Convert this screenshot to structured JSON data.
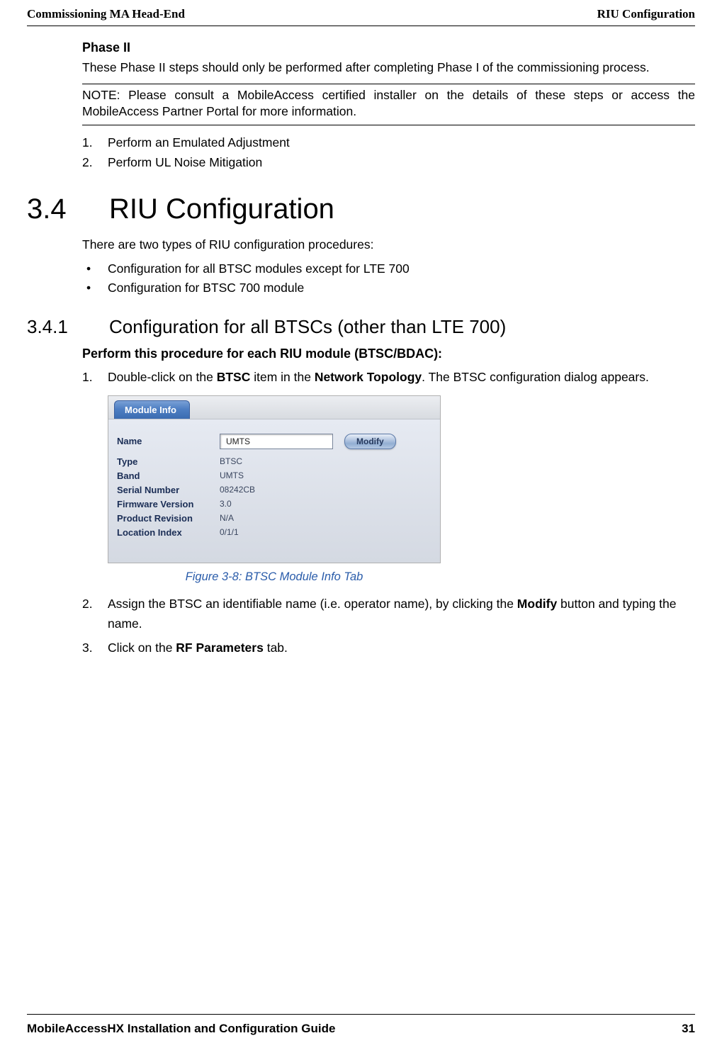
{
  "header": {
    "left": "Commissioning MA Head-End",
    "right": "RIU Configuration"
  },
  "phase2": {
    "title": "Phase II",
    "para": "These Phase II steps should only be performed after completing Phase I of the commissioning process.",
    "note": "NOTE: Please consult a MobileAccess certified installer on the details of these steps or access the MobileAccess Partner Portal for more information.",
    "items": [
      {
        "num": "1.",
        "text": "  Perform an Emulated Adjustment"
      },
      {
        "num": "2.",
        "text": "Perform UL Noise Mitigation"
      }
    ]
  },
  "s34": {
    "num": "3.4",
    "title": "RIU Configuration",
    "intro": "There are two types of RIU configuration procedures:",
    "bullets": [
      "Configuration for all  BTSC modules except for LTE 700",
      "Configuration for BTSC 700 module"
    ]
  },
  "s341": {
    "num": "3.4.1",
    "title": "Configuration for all BTSCs (other than LTE 700)",
    "subheading": "Perform this procedure for each RIU module (BTSC/BDAC):",
    "step1": {
      "num": "1.",
      "pre": "Double-click on the ",
      "b1": "BTSC",
      "mid": " item in the ",
      "b2": "Network Topology",
      "post": ". The BTSC configuration dialog appears."
    },
    "step2": {
      "num": "2.",
      "pre": "Assign the BTSC an identifiable name (i.e. operator name), by clicking the ",
      "b1": "Modify",
      "post": " button and typing the name."
    },
    "step3": {
      "num": "3.",
      "pre": "Click on the ",
      "b1": "RF Parameters",
      "post": " tab."
    }
  },
  "moduleInfo": {
    "tabLabel": "Module Info",
    "nameLabel": "Name",
    "nameValue": "UMTS",
    "modifyLabel": "Modify",
    "rows": [
      {
        "label": "Type",
        "value": "BTSC"
      },
      {
        "label": "Band",
        "value": "UMTS"
      },
      {
        "label": "Serial Number",
        "value": "08242CB"
      },
      {
        "label": "Firmware Version",
        "value": "3.0"
      },
      {
        "label": "Product Revision",
        "value": "N/A"
      },
      {
        "label": "Location Index",
        "value": "0/1/1"
      }
    ]
  },
  "figureCaption": "Figure 3-8: BTSC Module Info Tab",
  "footer": {
    "left": "MobileAccessHX Installation and Configuration Guide",
    "right": "31"
  }
}
